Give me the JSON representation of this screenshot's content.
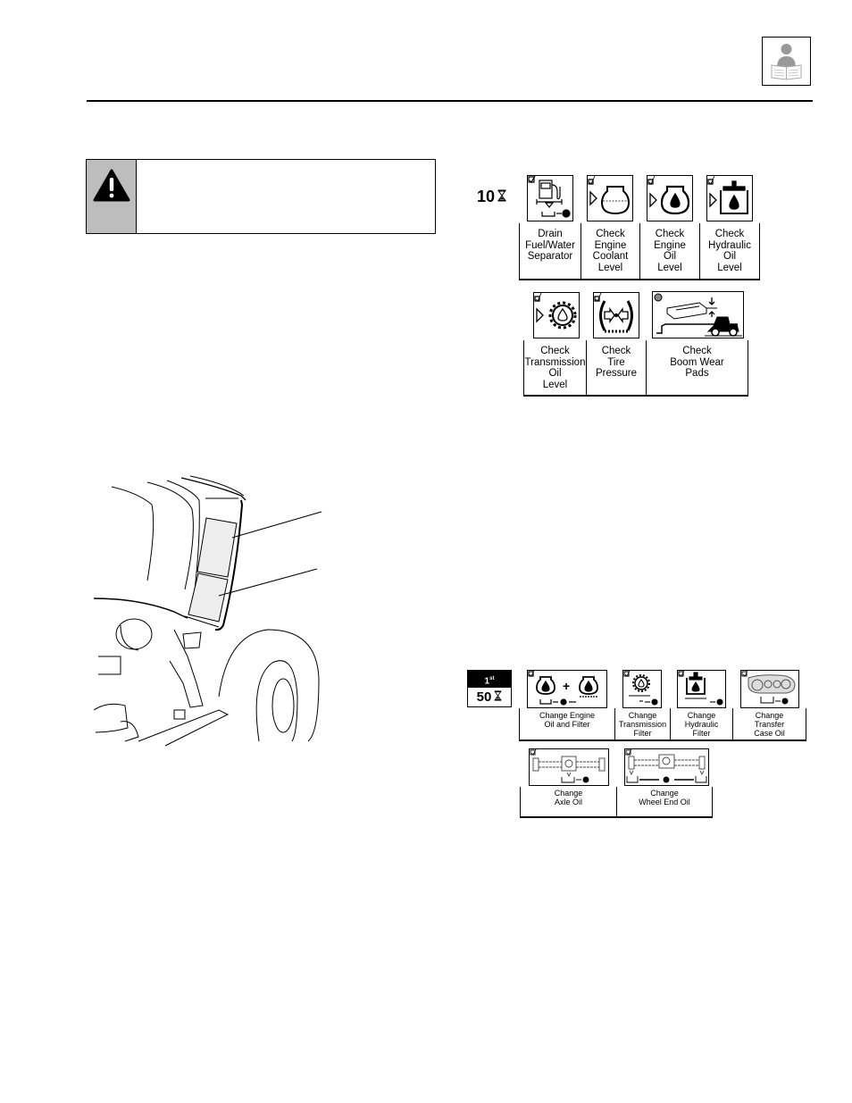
{
  "header": {
    "manual_icon": "read-manual-icon"
  },
  "warning": {
    "icon": "warning-triangle-icon",
    "text": ""
  },
  "schedule_10": {
    "interval": "10",
    "interval_icon": "hourglass-icon",
    "tasks": [
      {
        "label": "Drain\nFuel/Water\nSeparator",
        "icon": "fuel-water-separator-icon"
      },
      {
        "label": "Check\nEngine\nCoolant\nLevel",
        "icon": "engine-coolant-icon"
      },
      {
        "label": "Check\nEngine\nOil\nLevel",
        "icon": "engine-oil-icon"
      },
      {
        "label": "Check\nHydraulic\nOil\nLevel",
        "icon": "hydraulic-oil-icon"
      },
      {
        "label": "Check\nTransmission\nOil\nLevel",
        "icon": "transmission-oil-icon"
      },
      {
        "label": "Check\nTire\nPressure",
        "icon": "tire-pressure-icon"
      },
      {
        "label": "Check\nBoom Wear\nPads",
        "icon": "boom-wear-pads-icon"
      }
    ]
  },
  "schedule_first50": {
    "first_label": "1",
    "first_sup": "st",
    "interval": "50",
    "interval_icon": "hourglass-icon",
    "tasks": [
      {
        "label": "Change Engine\nOil and Filter",
        "icon": "engine-oil-filter-icon"
      },
      {
        "label": "Change\nTransmission\nFilter",
        "icon": "transmission-filter-icon"
      },
      {
        "label": "Change\nHydraulic\nFilter",
        "icon": "hydraulic-filter-icon"
      },
      {
        "label": "Change\nTransfer\nCase Oil",
        "icon": "transfer-case-icon"
      },
      {
        "label": "Change\nAxle Oil",
        "icon": "axle-oil-icon"
      },
      {
        "label": "Change\nWheel End Oil",
        "icon": "wheel-end-oil-icon"
      }
    ]
  },
  "illustration": {
    "name": "engine-compartment-decal-locations"
  }
}
